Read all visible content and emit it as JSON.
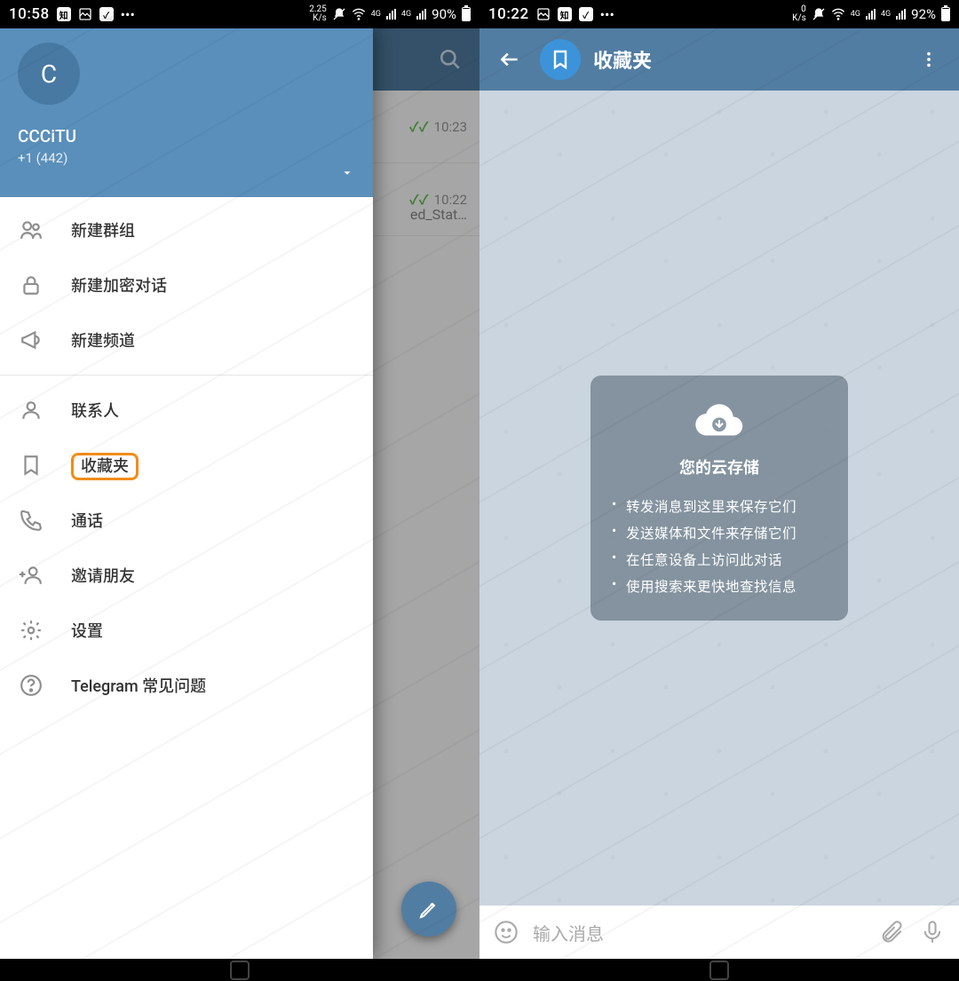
{
  "left": {
    "status": {
      "time": "10:58",
      "netspeed_top": "2.25",
      "netspeed_bot": "K/s",
      "net1": "4G",
      "net2": "4G",
      "battery_pct": "90%",
      "battery_fill": 90
    },
    "header_visible": {
      "search": true
    },
    "chat_rows": [
      {
        "time": "10:23",
        "checks": true,
        "sub": ""
      },
      {
        "time": "10:22",
        "checks": true,
        "sub": "ed_Stat…"
      }
    ],
    "drawer": {
      "avatar_initial": "C",
      "name": "CCCiTU",
      "phone": "+1 (442)",
      "items_top": [
        {
          "key": "new-group",
          "label": "新建群组",
          "icon": "group"
        },
        {
          "key": "new-secret",
          "label": "新建加密对话",
          "icon": "lock"
        },
        {
          "key": "new-channel",
          "label": "新建频道",
          "icon": "megaphone"
        }
      ],
      "items_bottom": [
        {
          "key": "contacts",
          "label": "联系人",
          "icon": "person"
        },
        {
          "key": "saved",
          "label": "收藏夹",
          "icon": "bookmark",
          "highlight": true
        },
        {
          "key": "calls",
          "label": "通话",
          "icon": "phone"
        },
        {
          "key": "invite",
          "label": "邀请朋友",
          "icon": "invite"
        },
        {
          "key": "settings",
          "label": "设置",
          "icon": "gear"
        },
        {
          "key": "faq",
          "label": "Telegram 常见问题",
          "icon": "help"
        }
      ]
    }
  },
  "right": {
    "status": {
      "time": "10:22",
      "netspeed_top": "0",
      "netspeed_bot": "K/s",
      "net1": "4G",
      "net2": "4G",
      "battery_pct": "92%",
      "battery_fill": 92
    },
    "header": {
      "title": "收藏夹"
    },
    "info_card": {
      "title": "您的云存储",
      "bullets": [
        "转发消息到这里来保存它们",
        "发送媒体和文件来存储它们",
        "在任意设备上访问此对话",
        "使用搜索来更快地查找信息"
      ]
    },
    "input": {
      "placeholder": "输入消息"
    }
  }
}
